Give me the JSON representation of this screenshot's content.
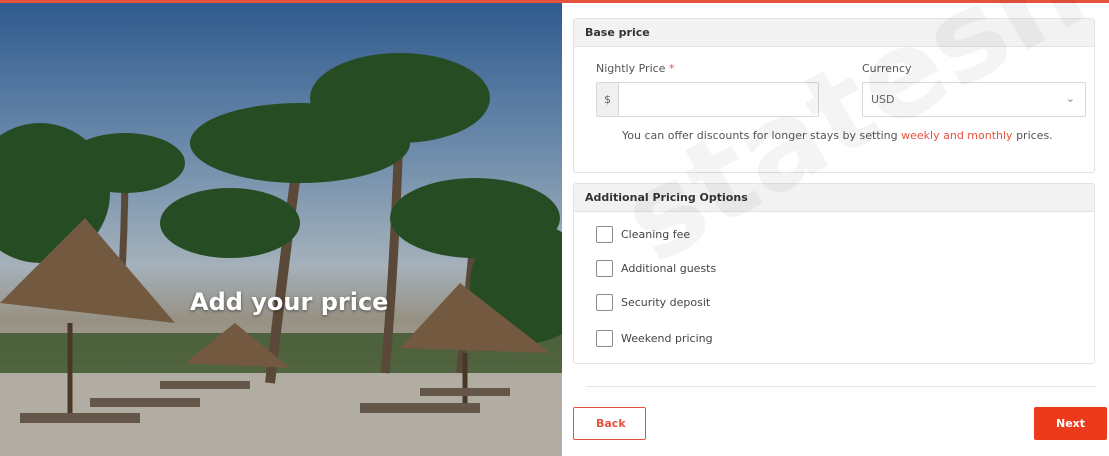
{
  "hero": {
    "title": "Add your price"
  },
  "base_price": {
    "heading": "Base price",
    "nightly_label": "Nightly Price",
    "required_mark": "*",
    "currency_symbol": "$",
    "nightly_value": "",
    "currency_label": "Currency",
    "currency_value": "USD",
    "hint_before": "You can offer discounts for longer stays by setting ",
    "hint_link": "weekly and monthly",
    "hint_after": " prices."
  },
  "additional": {
    "heading": "Additional Pricing Options",
    "options": [
      "Cleaning fee",
      "Additional guests",
      "Security deposit",
      "Weekend pricing"
    ]
  },
  "footer": {
    "back_label": "Back",
    "next_label": "Next"
  },
  "watermark": "stateshop",
  "colors": {
    "accent": "#e5533d",
    "next_button": "#ec3b1c"
  }
}
